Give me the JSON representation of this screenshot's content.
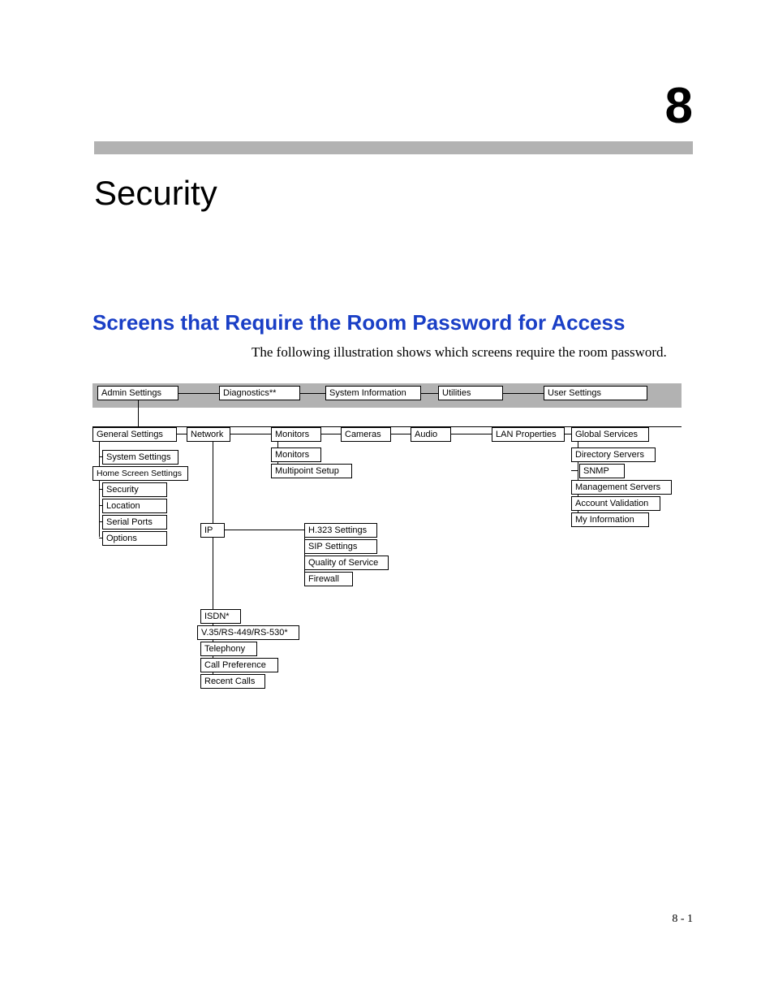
{
  "chapterNumber": "8",
  "chapterTitle": "Security",
  "sectionTitle": "Screens that Require the Room Password for Access",
  "intro": "The following illustration shows which screens require the room password.",
  "pageNumber": "8 - 1",
  "boxes": {
    "adminSettings": "Admin Settings",
    "diagnostics": "Diagnostics**",
    "systemInformation": "System Information",
    "utilities": "Utilities",
    "userSettings": "User Settings",
    "generalSettings": "General Settings",
    "network": "Network",
    "monitorsTop": "Monitors",
    "cameras": "Cameras",
    "audio": "Audio",
    "lanProperties": "LAN Properties",
    "globalServices": "Global Services",
    "systemSettings": "System Settings",
    "homeScreenSettings": "Home Screen Settings",
    "security": "Security",
    "location": "Location",
    "serialPorts": "Serial Ports",
    "options": "Options",
    "monitorsSub": "Monitors",
    "multipointSetup": "Multipoint Setup",
    "directoryServers": "Directory Servers",
    "snmp": "SNMP",
    "managementServers": "Management Servers",
    "accountValidation": "Account Validation",
    "myInformation": "My Information",
    "ip": "IP",
    "h323": "H.323 Settings",
    "sip": "SIP Settings",
    "qos": "Quality of Service",
    "firewall": "Firewall",
    "isdn": "ISDN*",
    "v35": "V.35/RS-449/RS-530*",
    "telephony": "Telephony",
    "callPreference": "Call Preference",
    "recentCalls": "Recent Calls"
  }
}
